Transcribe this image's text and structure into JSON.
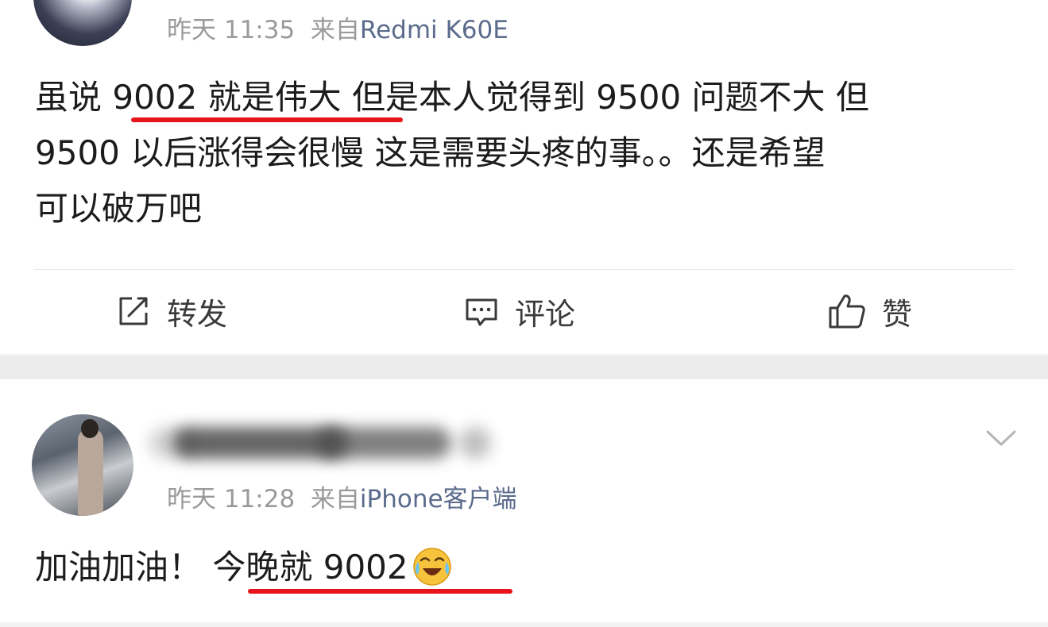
{
  "post1": {
    "time": "昨天 11:35",
    "from_label": "来自",
    "device": "Redmi K60E",
    "text_line1": "虽说 9002 就是伟大 但是本人觉得到 9500 问题不大 但",
    "text_line2": "9500 以后涨得会很慢 这是需要头疼的事。。还是希望",
    "text_line3": "可以破万吧",
    "actions": {
      "repost": "转发",
      "comment": "评论",
      "like": "赞"
    }
  },
  "post2": {
    "time": "昨天 11:28",
    "from_label": "来自",
    "device": "iPhone客户端",
    "text_plain": "加油加油！",
    "text_underlined": "今晚就 9002"
  },
  "colors": {
    "accent_underline": "#e8141b",
    "device_link": "#5b6b8c",
    "meta_gray": "#9a9a9a"
  }
}
